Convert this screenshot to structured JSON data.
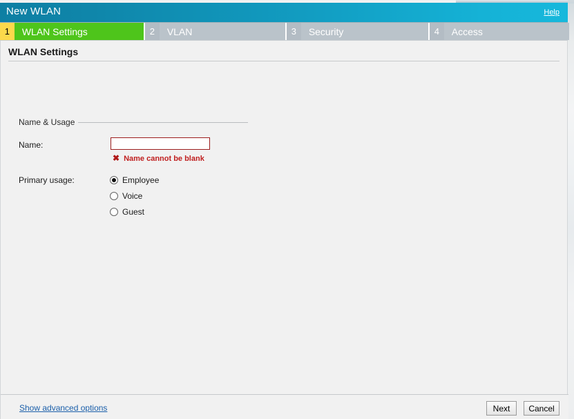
{
  "dialog": {
    "title": "New WLAN",
    "help_label": "Help"
  },
  "steps": [
    {
      "number": "1",
      "label": "WLAN Settings",
      "state": "active"
    },
    {
      "number": "2",
      "label": "VLAN",
      "state": "inactive"
    },
    {
      "number": "3",
      "label": "Security",
      "state": "inactive"
    },
    {
      "number": "4",
      "label": "Access",
      "state": "inactive"
    }
  ],
  "page": {
    "heading": "WLAN Settings",
    "section_label": "Name & Usage"
  },
  "form": {
    "name": {
      "label": "Name:",
      "value": "",
      "placeholder": "",
      "error_icon": "✖",
      "error_text": "Name cannot be blank"
    },
    "primary_usage": {
      "label": "Primary usage:",
      "selected": "Employee",
      "options": [
        {
          "label": "Employee",
          "checked": true
        },
        {
          "label": "Voice",
          "checked": false
        },
        {
          "label": "Guest",
          "checked": false
        }
      ]
    }
  },
  "footer": {
    "advanced_link": "Show advanced options",
    "next_label": "Next",
    "cancel_label": "Cancel"
  },
  "colors": {
    "titlebar_left": "#0e7fa3",
    "titlebar_right": "#16b8dc",
    "active_step_number_bg": "#fcd94b",
    "active_step_label_bg": "#4ec51b",
    "inactive_step_bg": "#bac3ca",
    "error_red": "#c02020",
    "input_error_border": "#9c1c1c",
    "link_blue": "#1b5faa"
  }
}
